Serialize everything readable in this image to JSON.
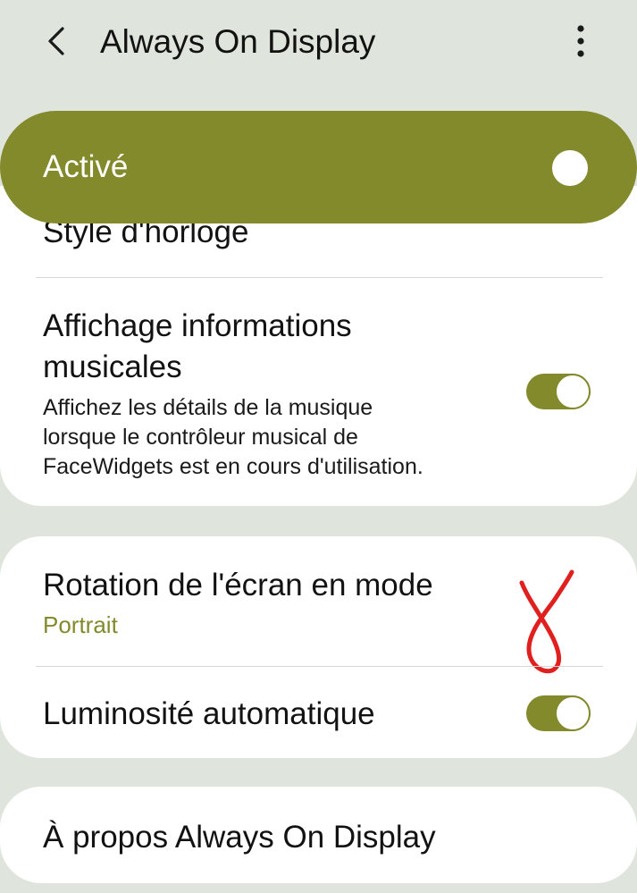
{
  "header": {
    "back_icon": "chevron-left-icon",
    "title": "Always On Display",
    "more_icon": "more-vertical-icon"
  },
  "master_switch": {
    "label": "Activé",
    "on": true
  },
  "settings": {
    "clock_style": {
      "label": "Style d'horloge"
    },
    "music_info": {
      "title_line1": "Affichage informations",
      "title_line2": "musicales",
      "desc_line1": "Affichez les détails de la musique",
      "desc_line2": "lorsque le contrôleur musical de",
      "desc_line3": "FaceWidgets est en cours d'utilisation.",
      "enabled": true
    },
    "screen_rotation": {
      "title": "Rotation de l'écran en mode",
      "value": "Portrait"
    },
    "auto_brightness": {
      "title": "Luminosité automatique",
      "enabled": true
    },
    "about": {
      "title": "À propos Always On Display"
    }
  },
  "colors": {
    "background": "#dfe5dc",
    "accent": "#838a2c",
    "card": "#ffffff",
    "annotation": "#e0201e"
  }
}
